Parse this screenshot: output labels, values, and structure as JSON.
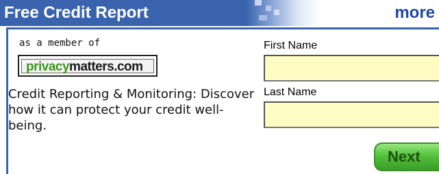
{
  "header": {
    "title": "Free Credit Report",
    "more_link": "more"
  },
  "sponsor": {
    "member_text": "as a member of",
    "logo": {
      "part1": "privacy",
      "part2": "matters",
      "part3": ".com"
    }
  },
  "description": "Credit Reporting & Monitoring: Discover how it can protect your credit well-being.",
  "form": {
    "first_name_label": "First Name",
    "first_name_value": "",
    "last_name_label": "Last Name",
    "last_name_value": "",
    "next_button": "Next"
  },
  "colors": {
    "header_blue": "#3a63ae",
    "link_blue": "#1f47a8",
    "field_bg": "#fffbc2",
    "button_green": "#53c23b",
    "logo_green": "#3c9a1e"
  }
}
